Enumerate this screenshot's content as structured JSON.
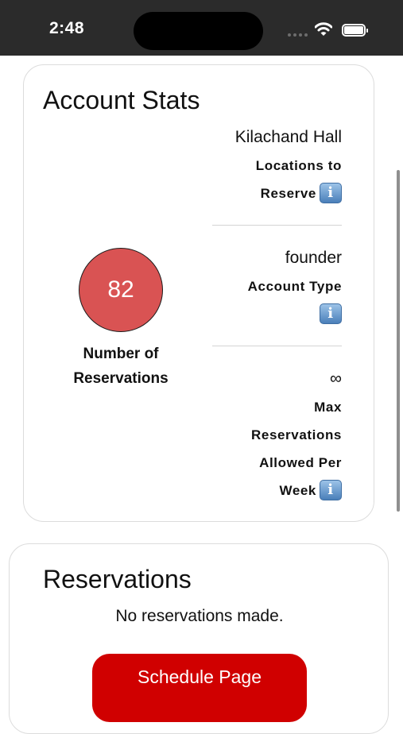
{
  "status_bar": {
    "time": "2:48"
  },
  "account_stats": {
    "title": "Account Stats",
    "reservations_count": "82",
    "reservations_label": "Number of Reservations",
    "location": {
      "value": "Kilachand Hall",
      "label_line1": "Locations to",
      "label_line2": "Reserve"
    },
    "account_type": {
      "value": "founder",
      "label": "Account Type"
    },
    "max_reservations": {
      "value": "∞",
      "label_line1": "Max",
      "label_line2": "Reservations",
      "label_line3": "Allowed Per",
      "label_line4": "Week"
    }
  },
  "reservations": {
    "title": "Reservations",
    "empty_message": "No reservations made.",
    "schedule_button": "Schedule Page"
  },
  "icons": {
    "info": "info-icon",
    "wifi": "wifi-icon",
    "battery": "battery-icon"
  },
  "colors": {
    "accent": "#d00000",
    "count_circle": "#d95353",
    "status_bar_bg": "#2b2b2b"
  }
}
